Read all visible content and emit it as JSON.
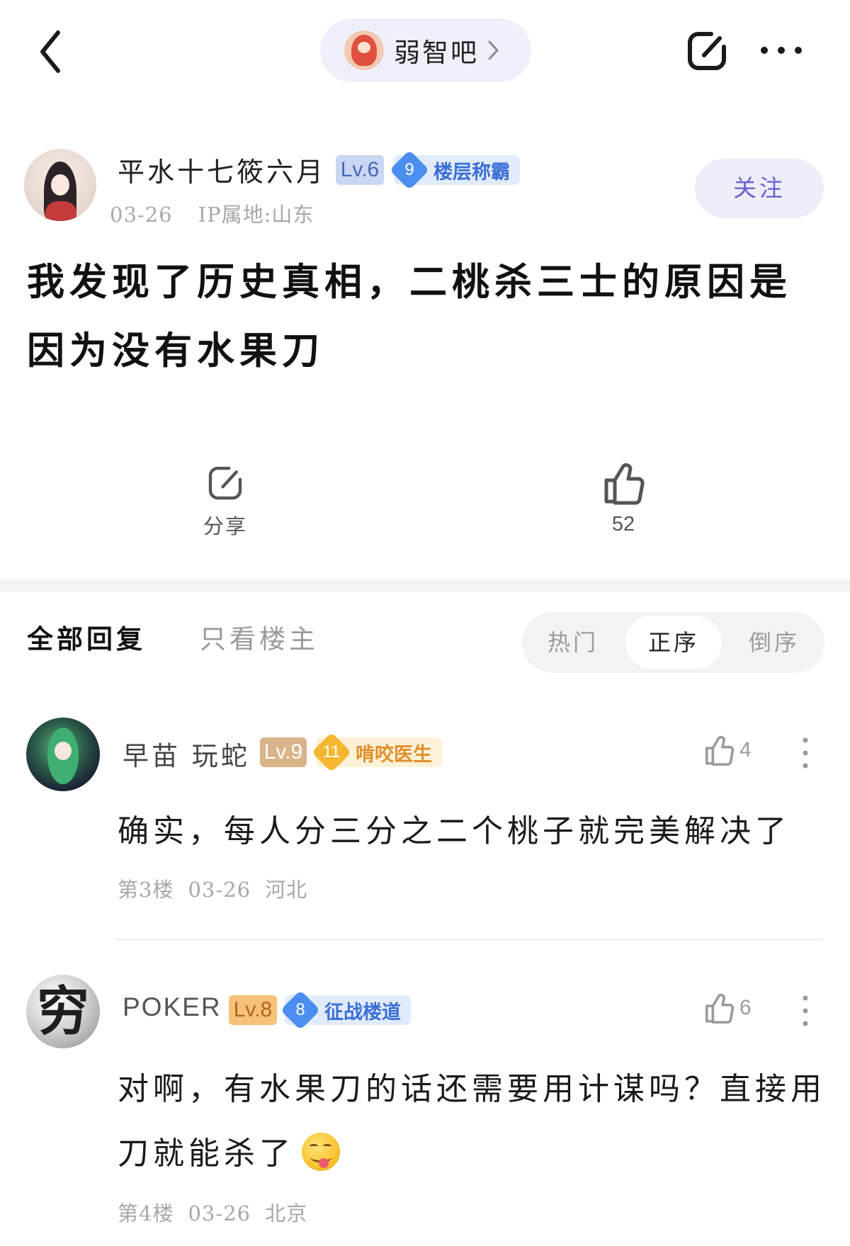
{
  "topbar": {
    "forum_name": "弱智吧",
    "back_icon": "chevron-left-icon",
    "share_icon": "share-icon",
    "more_icon": "more-dots-icon"
  },
  "author": {
    "name": "平水十七筱六月",
    "level": "Lv.6",
    "title_level": "9",
    "title": "楼层称霸",
    "date": "03-26",
    "ip": "IP属地:山东",
    "follow_label": "关注"
  },
  "post": {
    "title": "我发现了历史真相，二桃杀三士的原因是因为没有水果刀"
  },
  "actions": {
    "share_label": "分享",
    "like_count": "52"
  },
  "replies_header": {
    "tab_all": "全部回复",
    "tab_op_only": "只看楼主",
    "sort_options": [
      "热门",
      "正序",
      "倒序"
    ],
    "sort_selected": "正序"
  },
  "comments": [
    {
      "name": "早苗 玩蛇",
      "level": "Lv.9",
      "title_level": "11",
      "title": "啃咬医生",
      "likes": "4",
      "text": "确实，每人分三分之二个桃子就完美解决了",
      "floor": "第3楼",
      "date": "03-26",
      "location": "河北"
    },
    {
      "name": "POKER",
      "avatar_glyph": "穷",
      "level": "Lv.8",
      "title_level": "8",
      "title": "征战楼道",
      "likes": "6",
      "text": "对啊，有水果刀的话还需要用计谋吗？直接用刀就能杀了",
      "emoji": "yum-emoji-icon",
      "floor": "第4楼",
      "date": "03-26",
      "location": "北京"
    }
  ],
  "colors": {
    "accent": "#6b63d1",
    "pill_bg": "#eef1fb",
    "muted_text": "#a8a8a8"
  }
}
